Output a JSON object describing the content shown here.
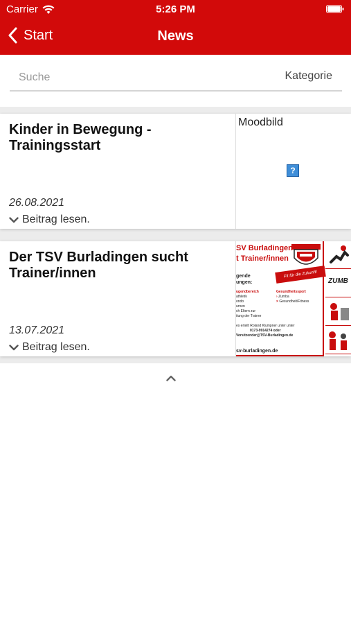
{
  "status_bar": {
    "carrier": "Carrier",
    "time": "5:26 PM"
  },
  "nav": {
    "back_label": "Start",
    "title": "News"
  },
  "search": {
    "placeholder": "Suche",
    "value": "",
    "category_label": "Kategorie"
  },
  "articles": [
    {
      "title": "Kinder in Bewegung - Trainingsstart",
      "date": "26.08.2021",
      "read_more": "Beitrag lesen.",
      "image_alt": "Moodbild",
      "broken_icon_glyph": "?"
    },
    {
      "title": "Der TSV Burladingen sucht Trainer/innen",
      "date": "13.07.2021",
      "read_more": "Beitrag lesen.",
      "poster": {
        "heading_1": "SV Burladingen",
        "heading_2": "t Trainer/innen",
        "subheading_1": "gende",
        "subheading_2": "ungen:",
        "left_col_title": "ugendbereich",
        "left_col_lines": [
          "athletik",
          "ondo",
          "urnen",
          "ch Eltern zur",
          "itung der Trainer"
        ],
        "right_col_title": "Gesundheitssport",
        "right_col_lines": [
          "Zumba",
          "Gesundheit/Fitness"
        ],
        "contact_lines": [
          "es erteilt Roland Klumpner unter unter",
          "0173-9914274 oder",
          "Vorsitzender@TSV-Burladingen.de"
        ],
        "banner": "Fit für die Zukunft!",
        "url": "sv-burladingen.de",
        "tile_text": "ZUMB"
      }
    }
  ],
  "colors": {
    "brand_red": "#d20a0a",
    "list_background": "#ececec"
  }
}
